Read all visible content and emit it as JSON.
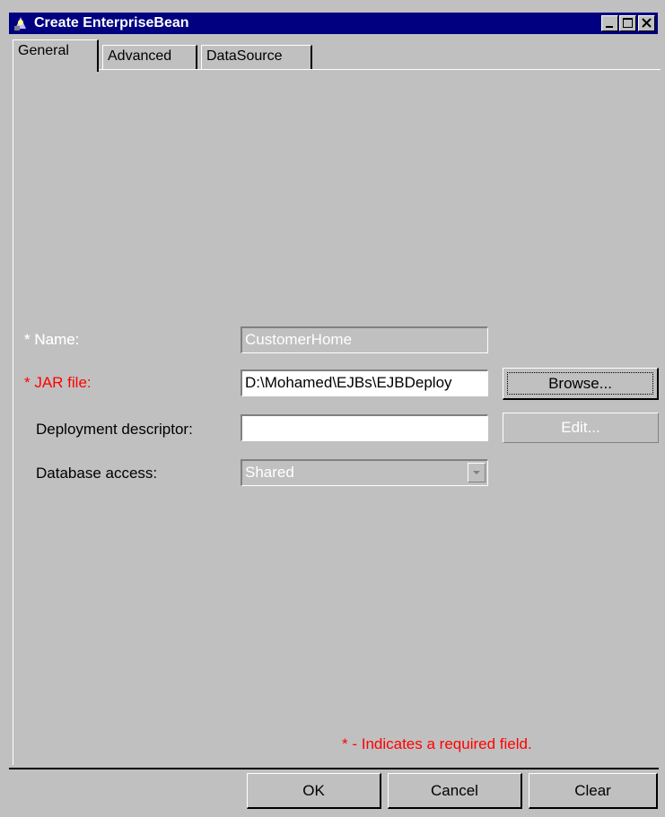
{
  "window": {
    "title": "Create EnterpriseBean",
    "icon": "enterprise-bean-icon",
    "controls": [
      "minimize-icon",
      "maximize-icon",
      "close-icon"
    ]
  },
  "tabs": [
    {
      "label": "General",
      "active": true
    },
    {
      "label": "Advanced",
      "active": false
    },
    {
      "label": "DataSource",
      "active": false
    }
  ],
  "form": {
    "name": {
      "label": "* Name:",
      "value": "CustomerHome",
      "enabled": false
    },
    "jar_file": {
      "label": "* JAR file:",
      "value": "D:\\Mohamed\\EJBs\\EJBDeploy",
      "required": true,
      "button": "Browse..."
    },
    "deployment_descriptor": {
      "label": "Deployment descriptor:",
      "value": "",
      "button": "Edit...",
      "button_enabled": false
    },
    "database_access": {
      "label": "Database access:",
      "value": "Shared",
      "enabled": false
    }
  },
  "required_note": "* - Indicates a required field.",
  "footer": {
    "ok": "OK",
    "cancel": "Cancel",
    "clear": "Clear"
  },
  "colors": {
    "title_bar": "#000080",
    "background": "#c0c0c0",
    "required": "#ff0000"
  }
}
